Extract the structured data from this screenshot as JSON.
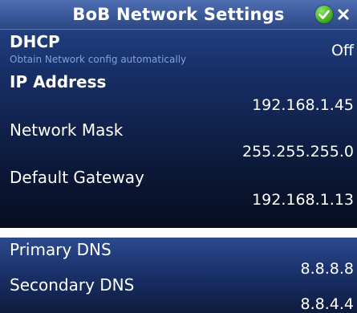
{
  "window": {
    "title": "BoB Network Settings",
    "confirm_icon": "checkmark-icon",
    "close_icon": "close-icon"
  },
  "settings": {
    "dhcp": {
      "label": "DHCP",
      "description": "Obtain Network config automatically",
      "value": "Off"
    },
    "ip_address": {
      "label": "IP Address",
      "value": "192.168.1.45"
    },
    "network_mask": {
      "label": "Network Mask",
      "value": "255.255.255.0"
    },
    "default_gateway": {
      "label": "Default Gateway",
      "value": "192.168.1.13"
    },
    "primary_dns": {
      "label": "Primary DNS",
      "value": "8.8.8.8"
    },
    "secondary_dns": {
      "label": "Secondary DNS",
      "value": "8.8.4.4"
    }
  },
  "colors": {
    "title_bar": "#3a5899",
    "panel_background": "#0c1a3c",
    "description_text": "#7fa2dc",
    "confirm_green": "#48b020"
  }
}
